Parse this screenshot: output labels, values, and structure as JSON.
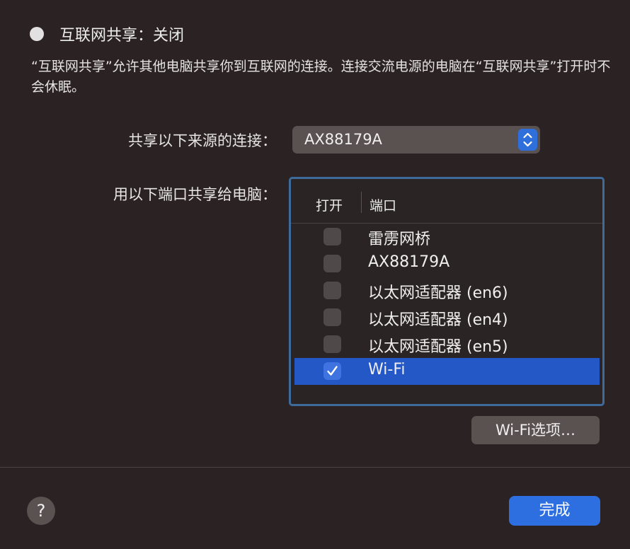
{
  "status": {
    "text": "互联网共享：关闭"
  },
  "description": "“互联网共享”允许其他电脑共享你到互联网的连接。连接交流电源的电脑在“互联网共享”打开时不会休眠。",
  "share_from": {
    "label": "共享以下来源的连接：",
    "value": "AX88179A"
  },
  "share_to": {
    "label": "用以下端口共享给电脑：",
    "columns": {
      "open": "打开",
      "port": "端口"
    },
    "ports": [
      {
        "name": "雷雳网桥",
        "checked": false,
        "selected": false
      },
      {
        "name": "AX88179A",
        "checked": false,
        "selected": false
      },
      {
        "name": "以太网适配器 (en6)",
        "checked": false,
        "selected": false
      },
      {
        "name": "以太网适配器 (en4)",
        "checked": false,
        "selected": false
      },
      {
        "name": "以太网适配器 (en5)",
        "checked": false,
        "selected": false
      },
      {
        "name": "Wi-Fi",
        "checked": true,
        "selected": true
      }
    ]
  },
  "wifi_options_label": "Wi-Fi选项…",
  "help_label": "?",
  "done_label": "完成",
  "colors": {
    "accent": "#2d6fe0",
    "selection": "#2458c6",
    "background": "#2b2323"
  }
}
